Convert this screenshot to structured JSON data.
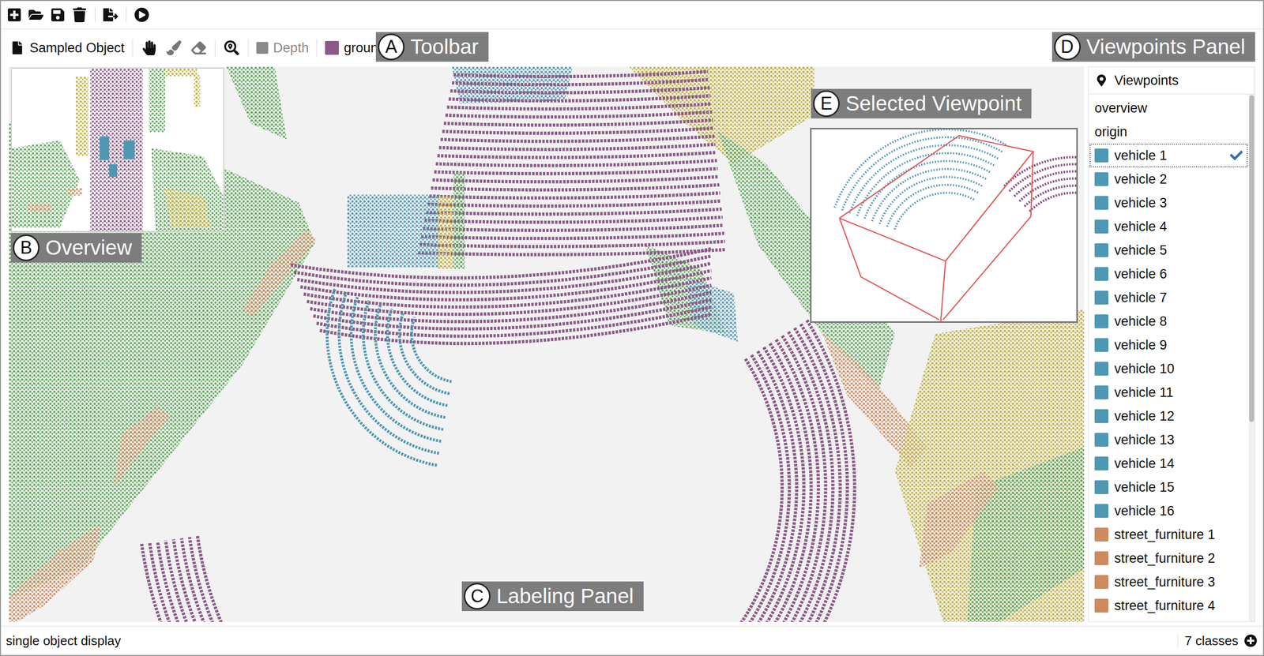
{
  "toolbar": {
    "object_mode": "Sampled Object",
    "depth": {
      "label": "Depth",
      "disabled": true
    },
    "class": {
      "label": "ground",
      "color": "#8c5a88"
    }
  },
  "callouts": [
    {
      "letter": "A",
      "label": "Toolbar"
    },
    {
      "letter": "B",
      "label": "Overview"
    },
    {
      "letter": "C",
      "label": "Labeling Panel"
    },
    {
      "letter": "D",
      "label": "Viewpoints Panel"
    },
    {
      "letter": "E",
      "label": "Selected Viewpoint"
    }
  ],
  "viewpoints": {
    "title": "Viewpoints",
    "scrollbar": {
      "level": 0.62
    },
    "items": [
      {
        "label": "overview",
        "kind": "view",
        "selected": false
      },
      {
        "label": "origin",
        "kind": "view",
        "selected": false
      },
      {
        "label": "vehicle 1",
        "kind": "object",
        "color": "#4f98b3",
        "selected": true
      },
      {
        "label": "vehicle 2",
        "kind": "object",
        "color": "#4f98b3",
        "selected": false
      },
      {
        "label": "vehicle 3",
        "kind": "object",
        "color": "#4f98b3",
        "selected": false
      },
      {
        "label": "vehicle 4",
        "kind": "object",
        "color": "#4f98b3",
        "selected": false
      },
      {
        "label": "vehicle 5",
        "kind": "object",
        "color": "#4f98b3",
        "selected": false
      },
      {
        "label": "vehicle 6",
        "kind": "object",
        "color": "#4f98b3",
        "selected": false
      },
      {
        "label": "vehicle 7",
        "kind": "object",
        "color": "#4f98b3",
        "selected": false
      },
      {
        "label": "vehicle 8",
        "kind": "object",
        "color": "#4f98b3",
        "selected": false
      },
      {
        "label": "vehicle 9",
        "kind": "object",
        "color": "#4f98b3",
        "selected": false
      },
      {
        "label": "vehicle 10",
        "kind": "object",
        "color": "#4f98b3",
        "selected": false
      },
      {
        "label": "vehicle 11",
        "kind": "object",
        "color": "#4f98b3",
        "selected": false
      },
      {
        "label": "vehicle 12",
        "kind": "object",
        "color": "#4f98b3",
        "selected": false
      },
      {
        "label": "vehicle 13",
        "kind": "object",
        "color": "#4f98b3",
        "selected": false
      },
      {
        "label": "vehicle 14",
        "kind": "object",
        "color": "#4f98b3",
        "selected": false
      },
      {
        "label": "vehicle 15",
        "kind": "object",
        "color": "#4f98b3",
        "selected": false
      },
      {
        "label": "vehicle 16",
        "kind": "object",
        "color": "#4f98b3",
        "selected": false
      },
      {
        "label": "street_furniture 1",
        "kind": "object",
        "color": "#cd8b5f",
        "selected": false
      },
      {
        "label": "street_furniture 2",
        "kind": "object",
        "color": "#cd8b5f",
        "selected": false
      },
      {
        "label": "street_furniture 3",
        "kind": "object",
        "color": "#cd8b5f",
        "selected": false
      },
      {
        "label": "street_furniture 4",
        "kind": "object",
        "color": "#cd8b5f",
        "selected": false
      }
    ]
  },
  "status_bar": {
    "mode": "single object display",
    "classes": "7 classes"
  }
}
